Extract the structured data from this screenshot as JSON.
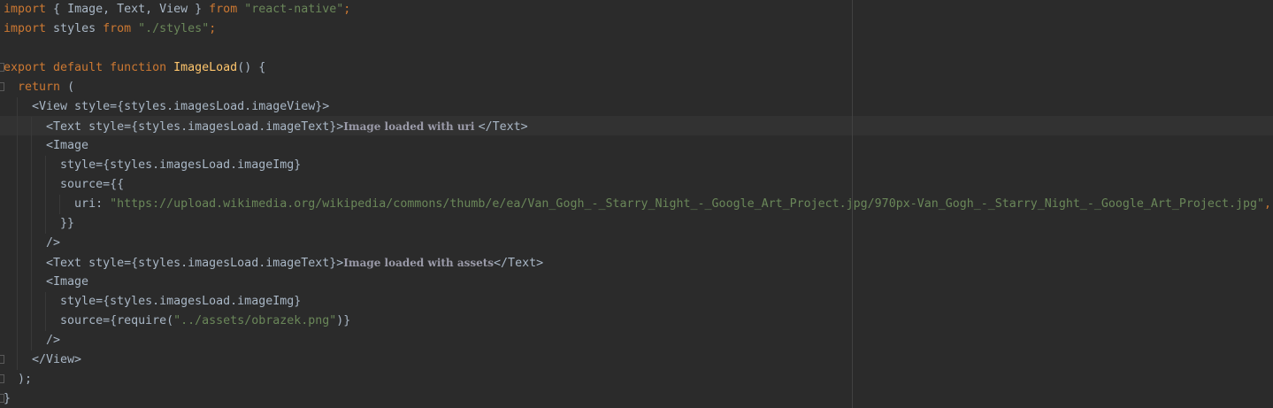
{
  "editor": {
    "lines": [
      {
        "tokens": [
          {
            "t": "kw",
            "v": "import"
          },
          {
            "t": "plain",
            "v": " { Image, Text, View } "
          },
          {
            "t": "kw",
            "v": "from"
          },
          {
            "t": "plain",
            "v": " "
          },
          {
            "t": "str",
            "v": "\"react-native\""
          },
          {
            "t": "kw",
            "v": ";"
          }
        ]
      },
      {
        "tokens": [
          {
            "t": "kw",
            "v": "import"
          },
          {
            "t": "plain",
            "v": " styles "
          },
          {
            "t": "kw",
            "v": "from"
          },
          {
            "t": "plain",
            "v": " "
          },
          {
            "t": "str",
            "v": "\"./styles\""
          },
          {
            "t": "kw",
            "v": ";"
          }
        ]
      },
      {
        "tokens": []
      },
      {
        "tokens": [
          {
            "t": "kw",
            "v": "export default function"
          },
          {
            "t": "plain",
            "v": " "
          },
          {
            "t": "fn",
            "v": "ImageLoad"
          },
          {
            "t": "plain",
            "v": "() {"
          }
        ]
      },
      {
        "tokens": [
          {
            "t": "plain",
            "v": "  "
          },
          {
            "t": "kw",
            "v": "return"
          },
          {
            "t": "plain",
            "v": " ("
          }
        ]
      },
      {
        "tokens": [
          {
            "t": "plain",
            "v": "    <View style={styles.imagesLoad.imageView}>"
          }
        ]
      },
      {
        "tokens": [
          {
            "t": "plain",
            "v": "      <Text style={styles.imagesLoad.imageText}>"
          },
          {
            "t": "jsxtext",
            "v": "Image loaded with uri "
          },
          {
            "t": "plain",
            "v": "</Text>"
          }
        ]
      },
      {
        "tokens": [
          {
            "t": "plain",
            "v": "      <Image"
          }
        ]
      },
      {
        "tokens": [
          {
            "t": "plain",
            "v": "        style={styles.imagesLoad.imageImg}"
          }
        ]
      },
      {
        "tokens": [
          {
            "t": "plain",
            "v": "        source={{"
          }
        ]
      },
      {
        "tokens": [
          {
            "t": "plain",
            "v": "          uri: "
          },
          {
            "t": "str",
            "v": "\"https://upload.wikimedia.org/wikipedia/commons/thumb/e/ea/Van_Gogh_-_Starry_Night_-_Google_Art_Project.jpg/970px-Van_Gogh_-_Starry_Night_-_Google_Art_Project.jpg\""
          },
          {
            "t": "kw",
            "v": ","
          }
        ]
      },
      {
        "tokens": [
          {
            "t": "plain",
            "v": "        }}"
          }
        ]
      },
      {
        "tokens": [
          {
            "t": "plain",
            "v": "      />"
          }
        ]
      },
      {
        "tokens": [
          {
            "t": "plain",
            "v": "      <Text style={styles.imagesLoad.imageText}>"
          },
          {
            "t": "jsxtext",
            "v": "Image loaded with assets"
          },
          {
            "t": "plain",
            "v": "</Text>"
          }
        ]
      },
      {
        "tokens": [
          {
            "t": "plain",
            "v": "      <Image"
          }
        ]
      },
      {
        "tokens": [
          {
            "t": "plain",
            "v": "        style={styles.imagesLoad.imageImg}"
          }
        ]
      },
      {
        "tokens": [
          {
            "t": "plain",
            "v": "        source={require("
          },
          {
            "t": "str",
            "v": "\"../assets/obrazek.png\""
          },
          {
            "t": "plain",
            "v": ")}"
          }
        ]
      },
      {
        "tokens": [
          {
            "t": "plain",
            "v": "      />"
          }
        ]
      },
      {
        "tokens": [
          {
            "t": "plain",
            "v": "    </View>"
          }
        ]
      },
      {
        "tokens": [
          {
            "t": "plain",
            "v": "  );"
          }
        ]
      },
      {
        "tokens": [
          {
            "t": "plain",
            "v": "}"
          }
        ]
      }
    ]
  },
  "colors": {
    "background": "#2b2b2b",
    "keyword": "#cc7832",
    "string": "#6a8759",
    "function": "#ffc66d",
    "text": "#a9b7c6"
  }
}
